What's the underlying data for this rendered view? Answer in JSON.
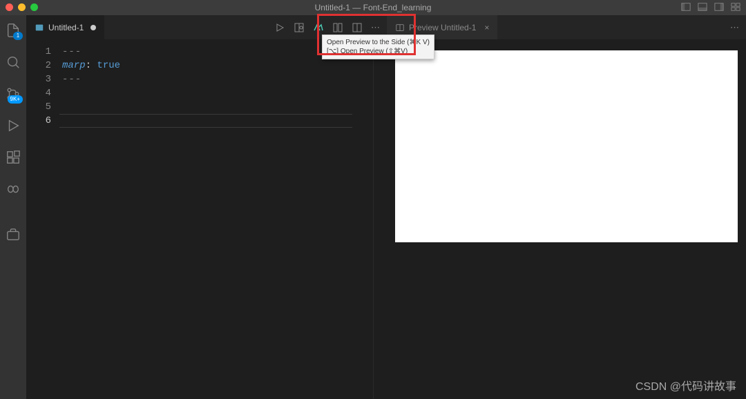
{
  "window": {
    "title": "Untitled-1 — Font-End_learning"
  },
  "tabs": {
    "left": {
      "label": "Untitled-1",
      "dirty": true
    },
    "right": {
      "label": "Preview Untitled-1"
    }
  },
  "tooltip": {
    "line1": "Open Preview to the Side (⌘K V)",
    "line2": "[⌥] Open Preview (⇧⌘V)"
  },
  "code": {
    "lines": [
      "---",
      "",
      "---",
      "",
      "",
      ""
    ],
    "key": "marp",
    "colon": ":",
    "value": "true",
    "gutter": [
      "1",
      "2",
      "3",
      "4",
      "5",
      "6"
    ]
  },
  "badges": {
    "explorer": "1",
    "source": "9K+"
  },
  "watermark": "CSDN @代码讲故事",
  "icons": {
    "explorer": "explorer-icon",
    "search": "search-icon",
    "source": "source-control-icon",
    "debug": "run-debug-icon",
    "extensions": "extensions-icon",
    "copilot": "copilot-icon",
    "briefcase": "briefcase-icon"
  }
}
